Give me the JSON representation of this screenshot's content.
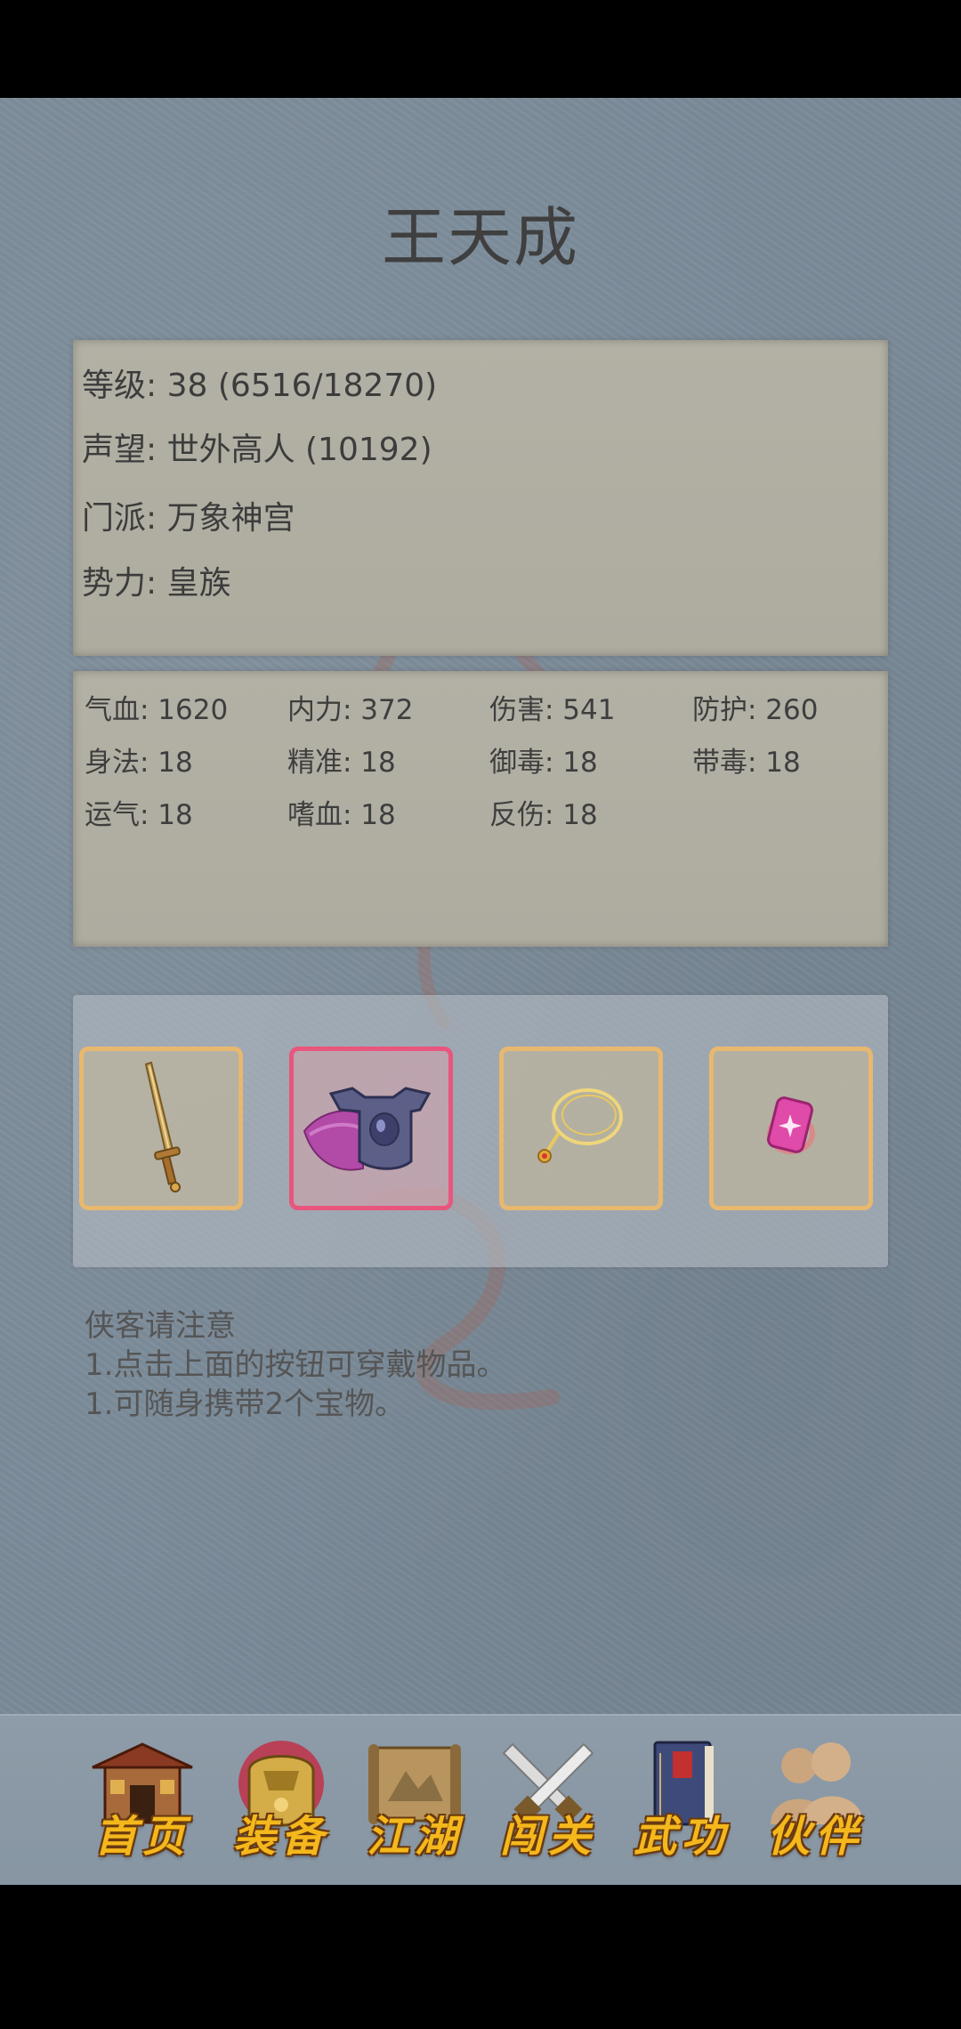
{
  "character": {
    "name": "王天成"
  },
  "info": {
    "level": "等级: 38 (6516/18270)",
    "reputation": "声望: 世外高人 (10192)",
    "sect": "门派: 万象神宫",
    "faction": "势力: 皇族"
  },
  "stats": [
    "气血: 1620",
    "内力: 372",
    "伤害: 541",
    "防护: 260",
    "身法: 18",
    "精准: 18",
    "御毒: 18",
    "带毒: 18",
    "运气: 18",
    "嗜血: 18",
    "反伤: 18"
  ],
  "equipment": {
    "slots": [
      {
        "icon": "sword-icon",
        "selected": false
      },
      {
        "icon": "armor-icon",
        "selected": true
      },
      {
        "icon": "necklace-icon",
        "selected": false
      },
      {
        "icon": "gem-icon",
        "selected": false
      }
    ],
    "colors": {
      "slot_border": "#e8b86e",
      "selected_border": "#e8567e"
    }
  },
  "notes": {
    "title": "侠客请注意",
    "line1": "1.点击上面的按钮可穿戴物品。",
    "line2": "1.可随身携带2个宝物。"
  },
  "nav": [
    {
      "label": "首页",
      "icon": "building-icon"
    },
    {
      "label": "装备",
      "icon": "helmet-icon"
    },
    {
      "label": "江湖",
      "icon": "map-scroll-icon"
    },
    {
      "label": "闯关",
      "icon": "crossed-swords-icon"
    },
    {
      "label": "武功",
      "icon": "book-icon"
    },
    {
      "label": "伙伴",
      "icon": "partners-icon"
    }
  ]
}
